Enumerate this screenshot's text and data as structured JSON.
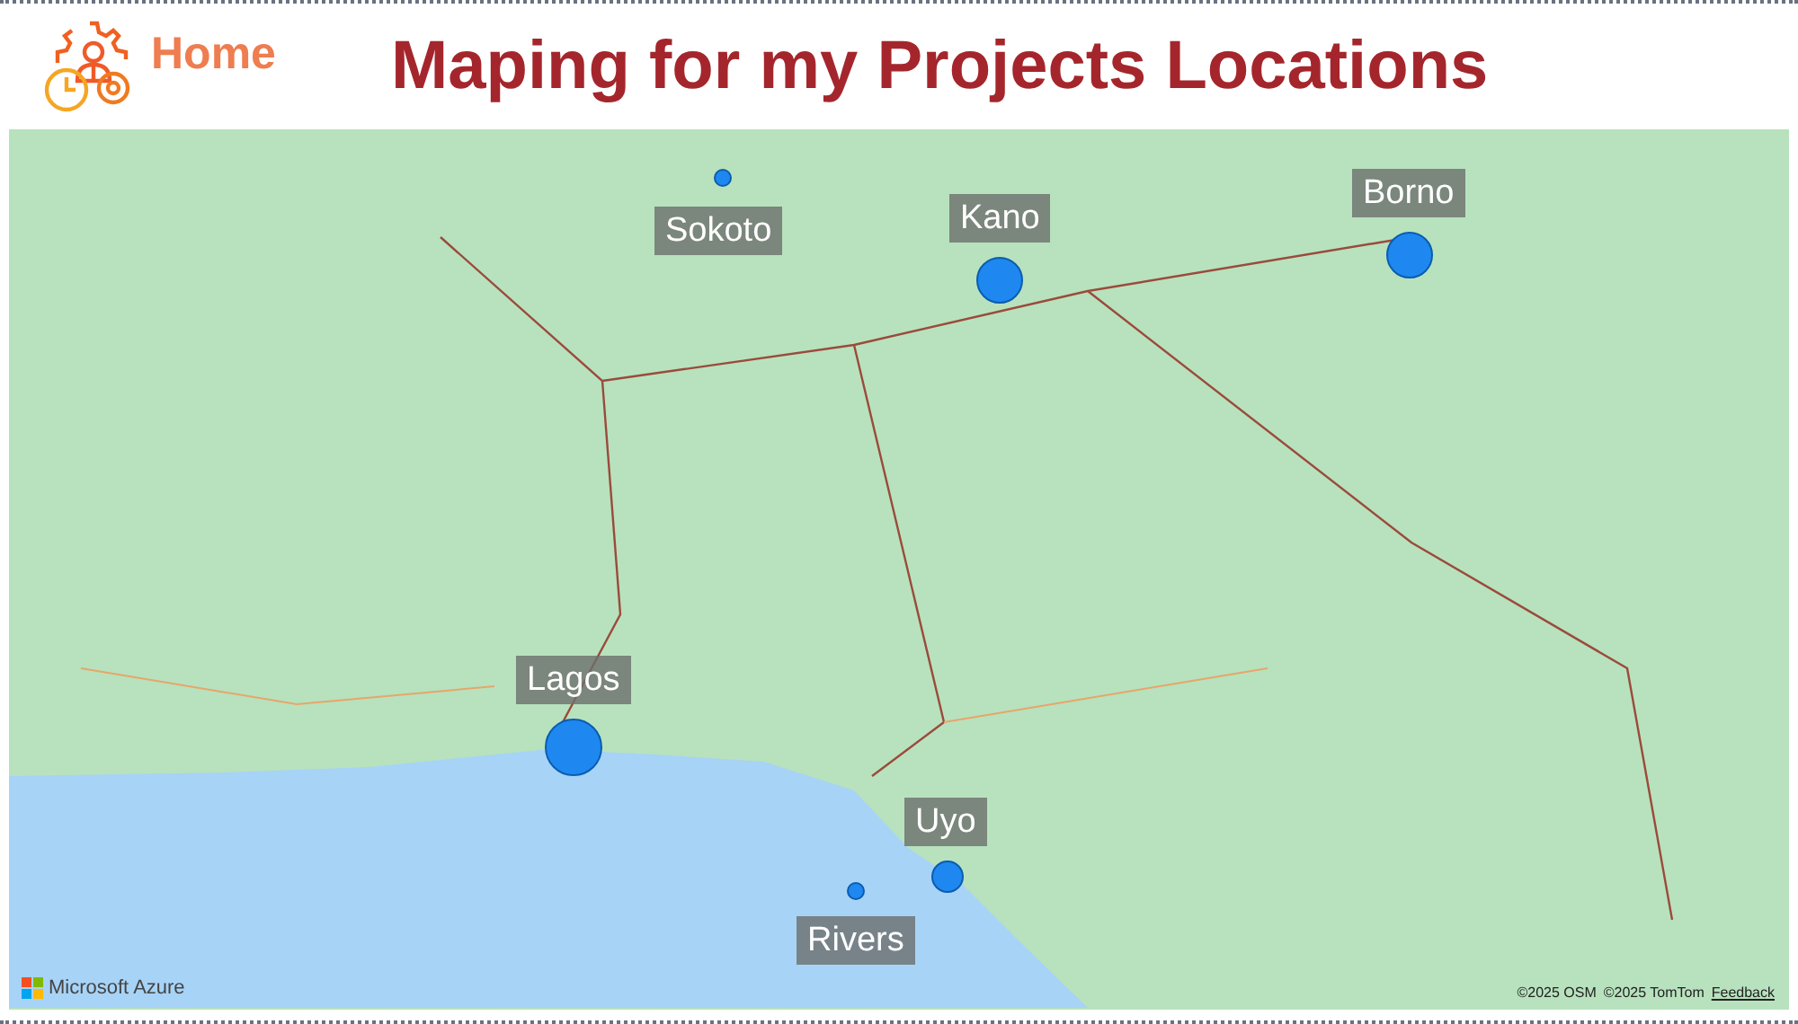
{
  "header": {
    "home_label": "Home",
    "title": "Maping for my Projects Locations"
  },
  "map": {
    "locations": [
      {
        "label": "Sokoto"
      },
      {
        "label": "Kano"
      },
      {
        "label": "Borno"
      },
      {
        "label": "Lagos"
      },
      {
        "label": "Uyo"
      },
      {
        "label": "Rivers"
      }
    ],
    "brand": "Microsoft Azure",
    "attribution": [
      "©2025 OSM",
      "©2025 TomTom"
    ],
    "feedback_link": "Feedback"
  }
}
